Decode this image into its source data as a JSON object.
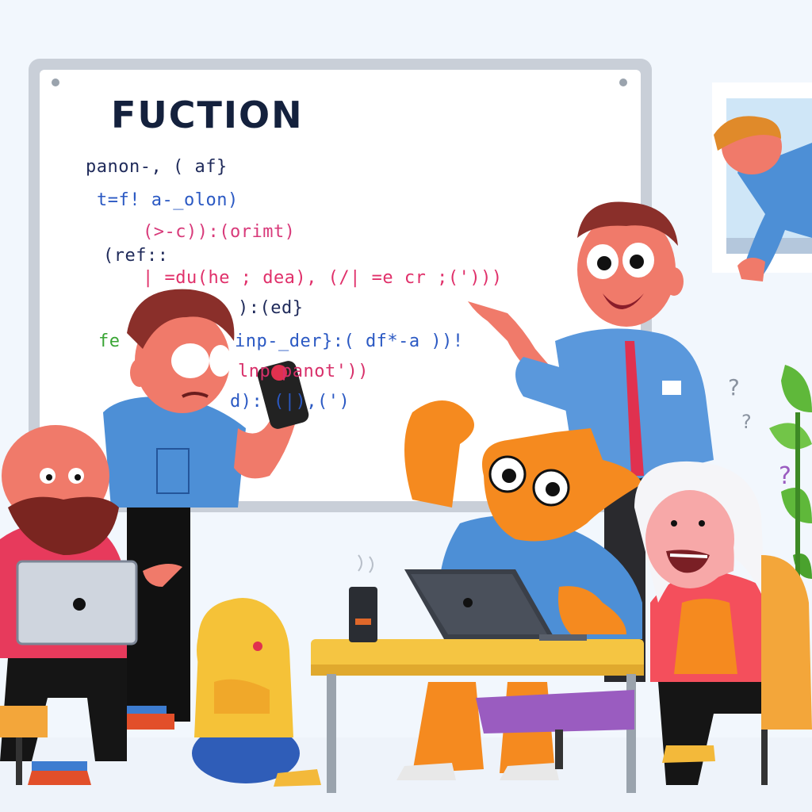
{
  "whiteboard": {
    "title": "FUCTION",
    "lines": [
      {
        "text": "panon-, ( af}",
        "color": "#1f2a5a"
      },
      {
        "text": "t=f! a-_olon)",
        "color": "#2b59c3"
      },
      {
        "text": "(>-c)):(orimt)",
        "color": "#d83a7a"
      },
      {
        "text": "(ref::",
        "color": "#1f2a5a"
      },
      {
        "text": "| =du(he ; dea), (/| =e cr ;(')))",
        "color": "#e0306a"
      },
      {
        "text": "):(ed}",
        "color": "#1f2a5a"
      },
      {
        "text": "fe",
        "color": "#3aa535"
      },
      {
        "text": "inp-_der}:( df*-a ))!",
        "color": "#2b59c3"
      },
      {
        "text": "lnp panot'))",
        "color": "#d8306a"
      },
      {
        "text": "d):  (|),(')",
        "color": "#2b59c3"
      }
    ]
  },
  "colors": {
    "background": "#f2f7fd",
    "whiteboard_frame": "#c9cfd8",
    "desk": "#f5c542",
    "accent_orange": "#f58a1f",
    "shirt_blue": "#4d8fd6"
  }
}
